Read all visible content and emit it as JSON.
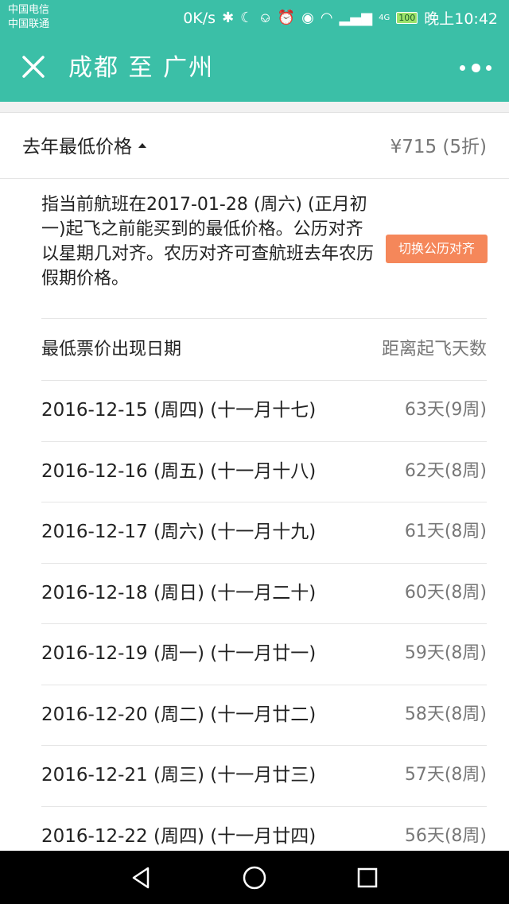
{
  "status_bar": {
    "carrier_1": "中国电信",
    "carrier_2": "中国联通",
    "speed": "0K/s",
    "network_label": "4G",
    "battery": "100",
    "time": "晚上10:42"
  },
  "header": {
    "title": "成都 至 广州"
  },
  "price_section": {
    "label": "去年最低价格",
    "value": "¥715 (5折)"
  },
  "info": {
    "text": "指当前航班在2017-01-28 (周六) (正月初一)起飞之前能买到的最低价格。公历对齐以星期几对齐。农历对齐可查航班去年农历假期价格。",
    "switch_button": "切换公历对齐"
  },
  "table": {
    "header_left": "最低票价出现日期",
    "header_right": "距离起飞天数",
    "rows": [
      {
        "date": "2016-12-15 (周四) (十一月十七)",
        "days": "63天(9周)"
      },
      {
        "date": "2016-12-16 (周五) (十一月十八)",
        "days": "62天(8周)"
      },
      {
        "date": "2016-12-17 (周六) (十一月十九)",
        "days": "61天(8周)"
      },
      {
        "date": "2016-12-18 (周日) (十一月二十)",
        "days": "60天(8周)"
      },
      {
        "date": "2016-12-19 (周一) (十一月廿一)",
        "days": "59天(8周)"
      },
      {
        "date": "2016-12-20 (周二) (十一月廿二)",
        "days": "58天(8周)"
      },
      {
        "date": "2016-12-21 (周三) (十一月廿三)",
        "days": "57天(8周)"
      },
      {
        "date": "2016-12-22 (周四) (十一月廿四)",
        "days": "56天(8周)"
      }
    ]
  },
  "colors": {
    "header_bg": "#3bbfa7",
    "switch_button_bg": "#f5875a",
    "nav_bg": "#000000"
  },
  "icons": {
    "close": "close-icon",
    "more": "more-icon",
    "back": "back-icon",
    "home": "home-icon",
    "recent": "recent-apps-icon"
  }
}
